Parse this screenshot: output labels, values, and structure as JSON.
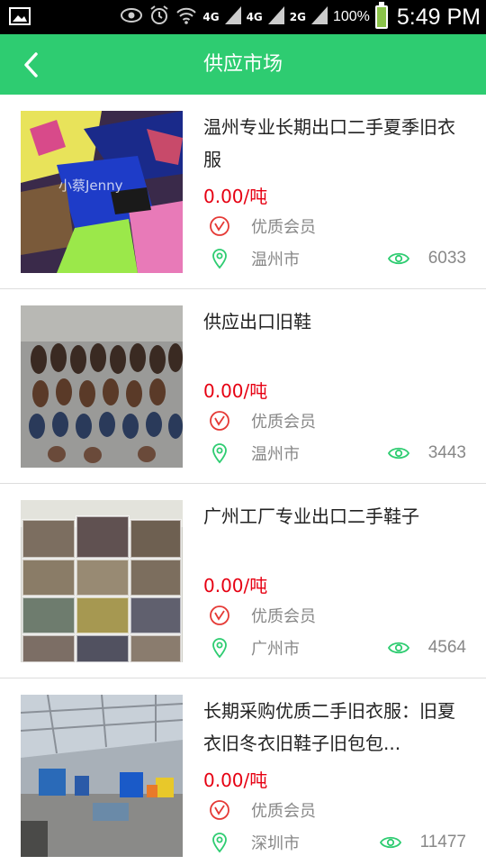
{
  "status_bar": {
    "network_1": "4G",
    "network_2": "4G",
    "network_3": "2G",
    "battery": "100%",
    "time": "5:49 PM"
  },
  "header": {
    "title": "供应市场"
  },
  "colors": {
    "accent": "#2ecc71",
    "price": "#e60012",
    "icon_green": "#2ecc71",
    "icon_red": "#e53935"
  },
  "listings": [
    {
      "title": "温州专业长期出口二手夏季旧衣服",
      "price": "0.00/吨",
      "member": "优质会员",
      "location": "温州市",
      "views": "6033",
      "image_watermark": "小蔡Jenny"
    },
    {
      "title": "供应出口旧鞋",
      "price": "0.00/吨",
      "member": "优质会员",
      "location": "温州市",
      "views": "3443"
    },
    {
      "title": "广州工厂专业出口二手鞋子",
      "price": "0.00/吨",
      "member": "优质会员",
      "location": "广州市",
      "views": "4564"
    },
    {
      "title": "长期采购优质二手旧衣服：旧夏衣旧冬衣旧鞋子旧包包...",
      "price": "0.00/吨",
      "member": "优质会员",
      "location": "深圳市",
      "views": "11477"
    }
  ]
}
